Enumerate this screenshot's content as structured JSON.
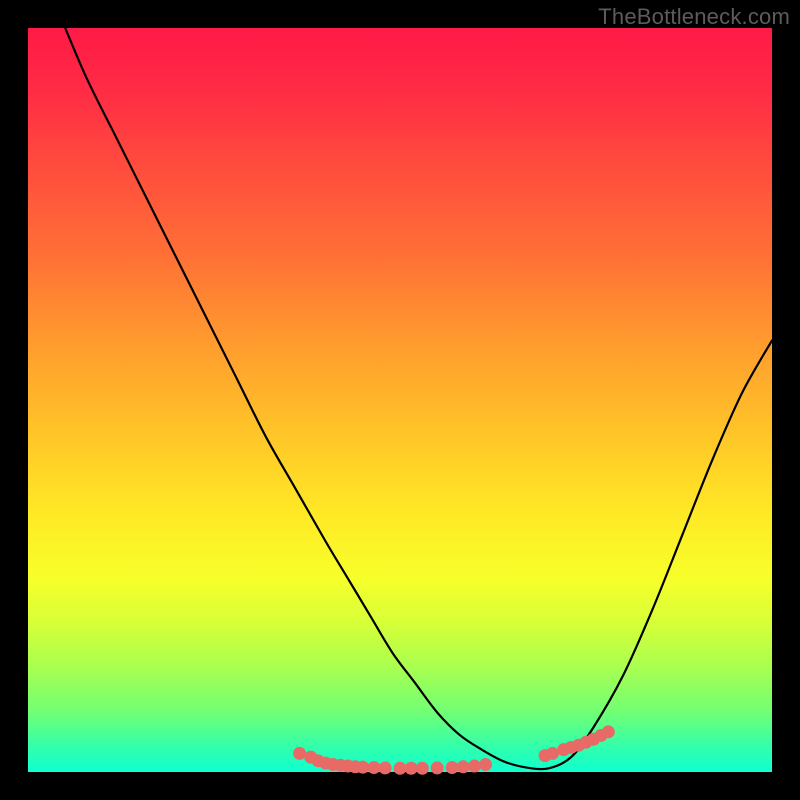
{
  "watermark": "TheBottleneck.com",
  "colors": {
    "frame": "#000000",
    "gradient_top": "#ff1a47",
    "gradient_mid": "#ffe825",
    "gradient_bottom": "#10ffd0",
    "curve": "#000000",
    "marker": "#e86a66"
  },
  "chart_data": {
    "type": "line",
    "title": "",
    "xlabel": "",
    "ylabel": "",
    "xlim": [
      0,
      100
    ],
    "ylim": [
      0,
      100
    ],
    "x": [
      5,
      8,
      12,
      16,
      20,
      24,
      28,
      32,
      36,
      40,
      43,
      46,
      49,
      52,
      55,
      58,
      61,
      64,
      67,
      70,
      73,
      76,
      80,
      84,
      88,
      92,
      96,
      100
    ],
    "values": [
      100,
      93,
      85,
      77,
      69,
      61,
      53,
      45,
      38,
      31,
      26,
      21,
      16,
      12,
      8,
      5,
      3,
      1.4,
      0.6,
      0.5,
      2,
      6,
      13,
      22,
      32,
      42,
      51,
      58
    ],
    "markers": {
      "x": [
        36.5,
        38,
        39,
        40,
        41,
        42,
        43,
        44,
        45,
        46.5,
        48,
        50,
        51.5,
        53,
        55,
        57,
        58.5,
        60,
        61.5,
        69.5,
        70.5,
        72,
        73,
        74,
        75,
        76,
        77,
        78
      ],
      "y": [
        2.5,
        2,
        1.5,
        1.2,
        1.0,
        0.9,
        0.8,
        0.7,
        0.65,
        0.6,
        0.55,
        0.5,
        0.5,
        0.5,
        0.55,
        0.6,
        0.7,
        0.8,
        1.0,
        2.2,
        2.5,
        3.0,
        3.3,
        3.6,
        4.0,
        4.4,
        4.9,
        5.4
      ]
    }
  }
}
